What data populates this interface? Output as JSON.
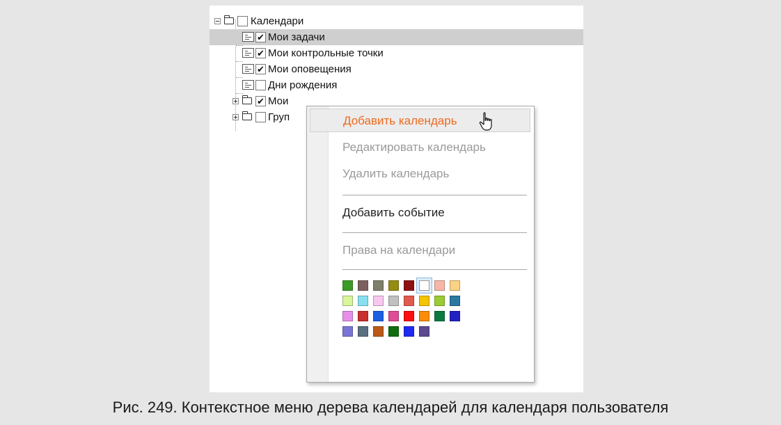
{
  "tree": {
    "root": {
      "label": "Календари",
      "icon": "folder-open-icon",
      "checked": false
    },
    "items": [
      {
        "label": "Мои задачи",
        "icon": "calendar-list-icon",
        "checked": true,
        "selected": true
      },
      {
        "label": "Мои контрольные точки",
        "icon": "calendar-list-icon",
        "checked": true
      },
      {
        "label": "Мои оповещения",
        "icon": "calendar-list-icon",
        "checked": true
      },
      {
        "label": "Дни рождения",
        "icon": "calendar-list-icon",
        "checked": false
      },
      {
        "label": "Мои",
        "icon": "folder-icon",
        "checked": true,
        "expandable": true
      },
      {
        "label": "Груп",
        "icon": "folder-icon",
        "checked": false,
        "expandable": true
      }
    ],
    "check_glyph": "✔"
  },
  "context_menu": {
    "items": {
      "add_calendar": "Добавить календарь",
      "edit_calendar": "Редактировать календарь",
      "delete_calendar": "Удалить календарь",
      "add_event": "Добавить событие",
      "calendar_rights": "Права на календари"
    },
    "hover_color": "#ee6a1d",
    "cursor_icon": "hand-pointer-icon",
    "palette": [
      "#3c9a26",
      "#7c6060",
      "#7f806a",
      "#958c12",
      "#8e1010",
      "#ffffff",
      "#f6b7a9",
      "#fbd283",
      "#d8f59a",
      "#87e0f0",
      "#f6c8ef",
      "#c0c0c0",
      "#e05a4e",
      "#f4c500",
      "#9acb34",
      "#2a79a1",
      "#e68fe8",
      "#c92f2c",
      "#1b62e1",
      "#df4d96",
      "#ff1010",
      "#fb8c0a",
      "#0b7a3f",
      "#2121c3",
      "#7a74d6",
      "#5a6f80",
      "#bb5a18",
      "#0f6c0f",
      "#1e2af0",
      "#5b4a8e"
    ],
    "palette_selected_index": 5
  },
  "caption": "Рис. 249. Контекстное меню дерева календарей для календаря пользователя"
}
